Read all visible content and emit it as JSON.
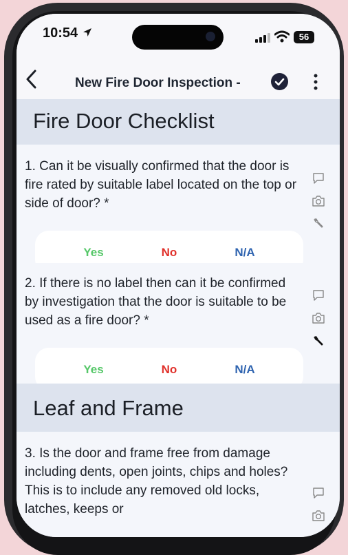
{
  "status": {
    "time": "10:54",
    "battery": "56"
  },
  "header": {
    "title": "New Fire Door Inspection -"
  },
  "sections": [
    {
      "title": "Fire Door Checklist"
    },
    {
      "title": "Leaf and Frame"
    }
  ],
  "questions": [
    {
      "text": "1. Can it be visually confirmed that the door is fire rated by suitable label located on the top or side of door? *"
    },
    {
      "text": "2. If there is no label then can it be confirmed by investigation that the door is suitable to be used as a fire door? *"
    },
    {
      "text": "3. Is the door and frame free from damage including dents, open joints, chips and holes? This is to include any removed old locks, latches, keeps or"
    }
  ],
  "options": {
    "yes": "Yes",
    "no": "No",
    "na": "N/A"
  },
  "icons": [
    "comment-icon",
    "camera-icon",
    "wrench-icon"
  ],
  "colors": {
    "yes": "#55c768",
    "no": "#e0312b",
    "na": "#2f64b0",
    "section_bg": "#dde3ee"
  }
}
